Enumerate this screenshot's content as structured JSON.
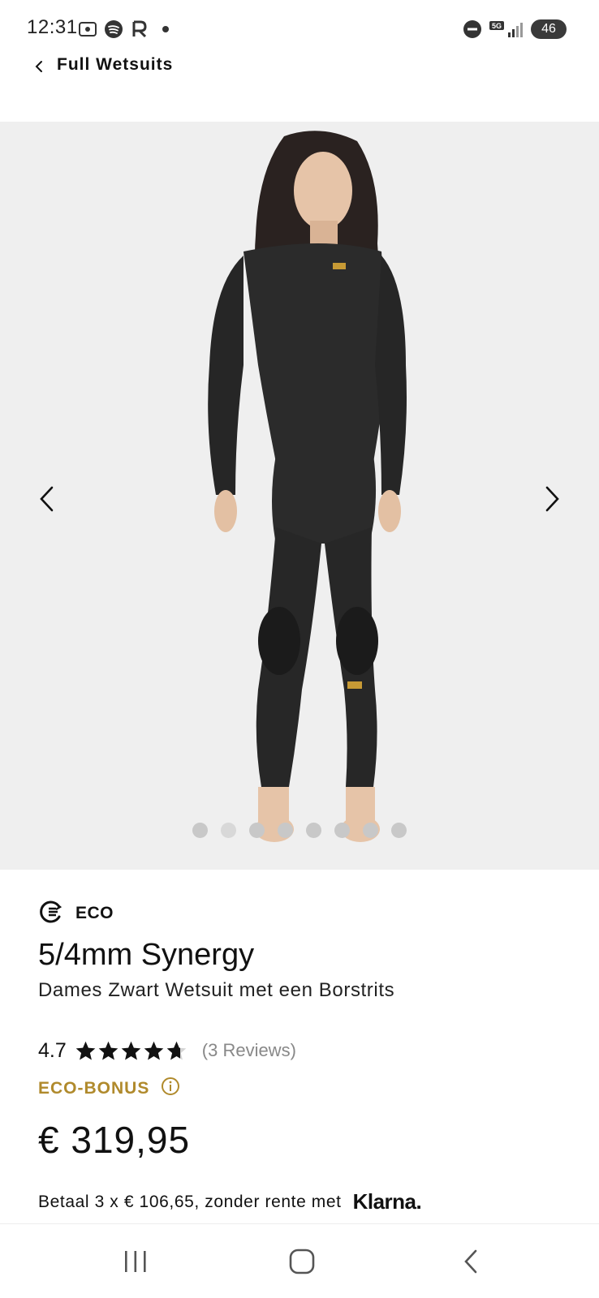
{
  "status_bar": {
    "time": "12:31",
    "battery": "46",
    "network": "5G"
  },
  "header": {
    "back_label": "Full Wetsuits"
  },
  "gallery": {
    "total_images": 8,
    "current_index": 1
  },
  "product": {
    "eco_label": "ECO",
    "name": "5/4mm Synergy",
    "subtitle": "Dames Zwart Wetsuit met een Borstrits",
    "rating": "4.7",
    "rating_value": 4.7,
    "reviews": "(3 Reviews)",
    "eco_bonus": "ECO-BONUS",
    "price": "€ 319,95",
    "klarna_text": "Betaal 3 x € 106,65, zonder rente met",
    "klarna_logo": "Klarna."
  },
  "colors": {
    "accent_gold": "#b08a2c",
    "text": "#111111",
    "muted": "#888888"
  }
}
